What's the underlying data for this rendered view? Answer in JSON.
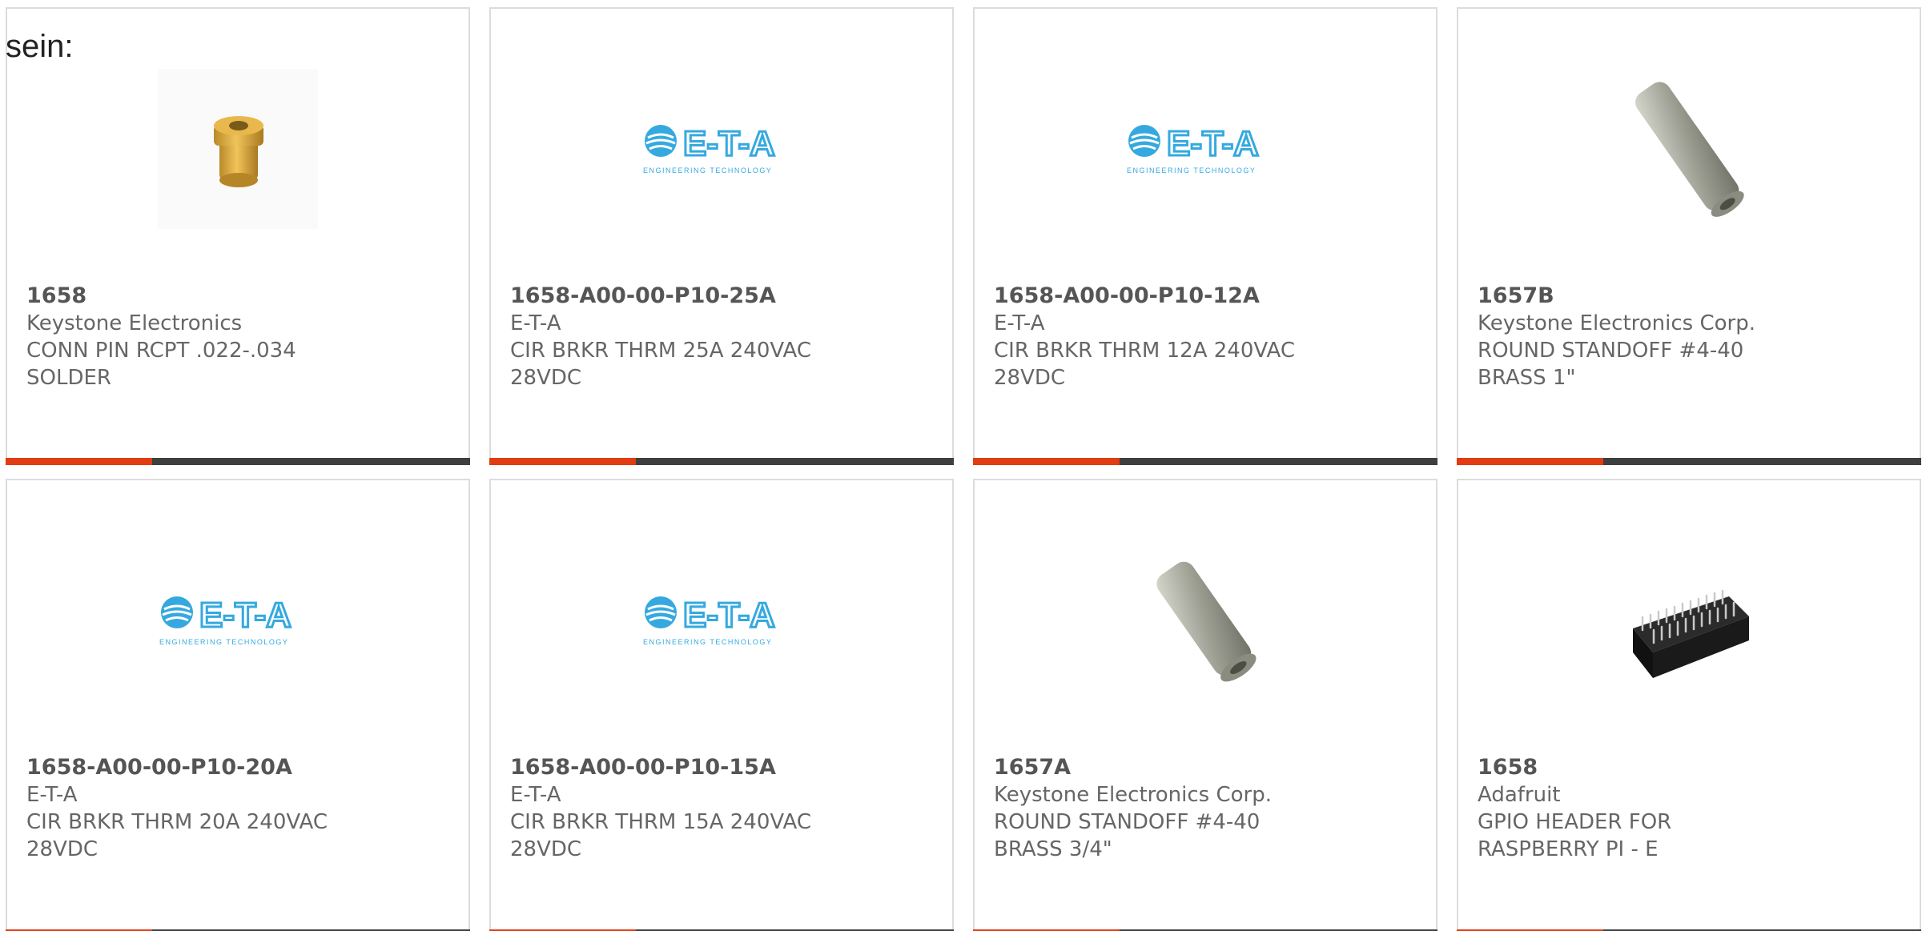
{
  "lead_text": "sein:",
  "colors": {
    "accent": "#e23c12",
    "bar": "#3f3f3f",
    "eta_blue": "#35a9df",
    "brass": "#d9a437",
    "steel": "#a4a69b",
    "header_black": "#1c1c1c"
  },
  "logo_text": {
    "name": "E-T-A",
    "tagline": "ENGINEERING TECHNOLOGY"
  },
  "products": [
    {
      "part": "1658",
      "maker": "Keystone Electronics",
      "description": "CONN PIN RCPT .022-.034 SOLDER",
      "image": "brass-pin-receptacle"
    },
    {
      "part": "1658-A00-00-P10-25A",
      "maker": "E-T-A",
      "description": "CIR BRKR THRM 25A 240VAC 28VDC",
      "image": "eta-logo"
    },
    {
      "part": "1658-A00-00-P10-12A",
      "maker": "E-T-A",
      "description": "CIR BRKR THRM 12A 240VAC 28VDC",
      "image": "eta-logo"
    },
    {
      "part": "1657B",
      "maker": "Keystone Electronics Corp.",
      "description": "ROUND STANDOFF #4-40 BRASS 1\"",
      "image": "round-standoff-long"
    },
    {
      "part": "1658-A00-00-P10-20A",
      "maker": "E-T-A",
      "description": "CIR BRKR THRM 20A 240VAC 28VDC",
      "image": "eta-logo"
    },
    {
      "part": "1658-A00-00-P10-15A",
      "maker": "E-T-A",
      "description": "CIR BRKR THRM 15A 240VAC 28VDC",
      "image": "eta-logo"
    },
    {
      "part": "1657A",
      "maker": "Keystone Electronics Corp.",
      "description": "ROUND STANDOFF #4-40 BRASS 3/4\"",
      "image": "round-standoff-short"
    },
    {
      "part": "1658",
      "maker": "Adafruit",
      "description": "GPIO HEADER FOR RASPBERRY PI - E",
      "image": "gpio-header"
    }
  ]
}
